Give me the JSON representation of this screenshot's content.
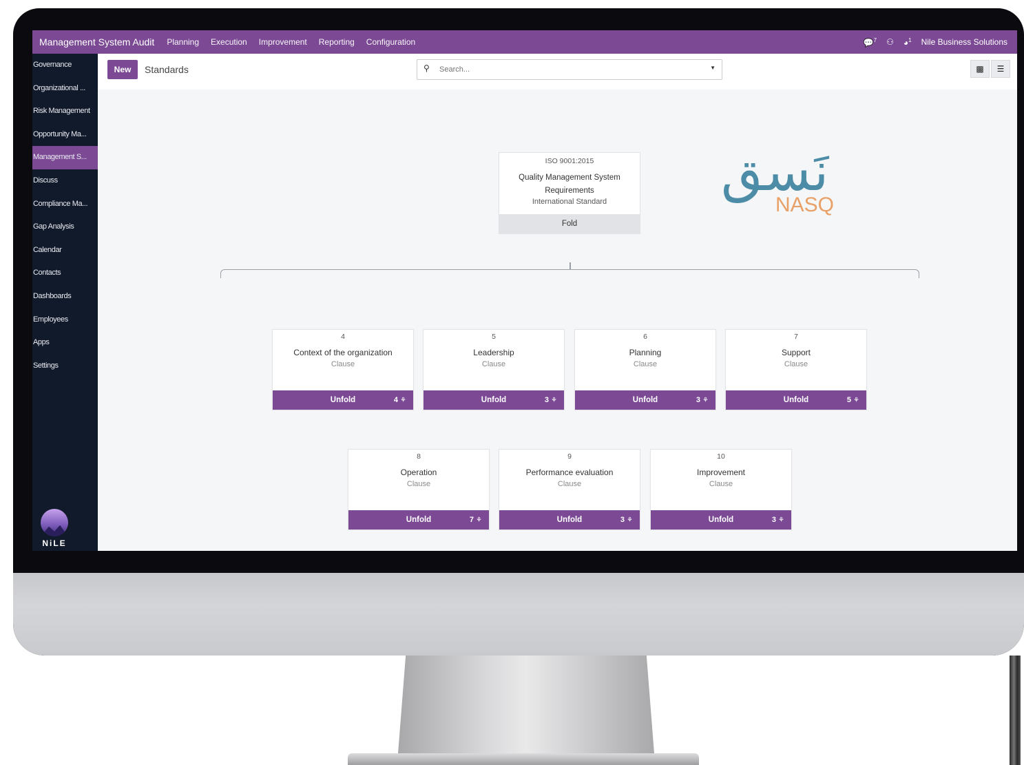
{
  "topbar": {
    "app_title": "Management System Audit",
    "menu": [
      "Planning",
      "Execution",
      "Improvement",
      "Reporting",
      "Configuration"
    ],
    "chat_badge": "7",
    "activity_badge": "1",
    "company": "Nile Business Solutions"
  },
  "sidebar": {
    "items": [
      "Governance",
      "Organizational ...",
      "Risk Management",
      "Opportunity Ma...",
      "Management S...",
      "Discuss",
      "Compliance Ma...",
      "Gap Analysis",
      "Calendar",
      "Contacts",
      "Dashboards",
      "Employees",
      "Apps",
      "Settings"
    ],
    "active_index": 4,
    "logo_text": "NiLE"
  },
  "control": {
    "new_label": "New",
    "breadcrumb": "Standards",
    "search_placeholder": "Search..."
  },
  "root": {
    "standard": "ISO 9001:2015",
    "title_line1": "Quality Management System",
    "title_line2": "Requirements",
    "subtitle": "International Standard",
    "fold_label": "Fold"
  },
  "clauses": [
    {
      "num": "4",
      "name": "Context of the organization",
      "type": "Clause",
      "button": "Unfold",
      "count": "4"
    },
    {
      "num": "5",
      "name": "Leadership",
      "type": "Clause",
      "button": "Unfold",
      "count": "3"
    },
    {
      "num": "6",
      "name": "Planning",
      "type": "Clause",
      "button": "Unfold",
      "count": "3"
    },
    {
      "num": "7",
      "name": "Support",
      "type": "Clause",
      "button": "Unfold",
      "count": "5"
    },
    {
      "num": "8",
      "name": "Operation",
      "type": "Clause",
      "button": "Unfold",
      "count": "7"
    },
    {
      "num": "9",
      "name": "Performance evaluation",
      "type": "Clause",
      "button": "Unfold",
      "count": "3"
    },
    {
      "num": "10",
      "name": "Improvement",
      "type": "Clause",
      "button": "Unfold",
      "count": "3"
    }
  ],
  "brand": {
    "arabic": "نَسق",
    "latin": "NASQ"
  },
  "colors": {
    "accent": "#7c4a95",
    "sidebar_bg": "#111a2a",
    "fold_bg": "#e1e3e6",
    "nasq_teal": "#4d8ca6",
    "nasq_orange": "#e9a066"
  },
  "icons": [
    "chat-icon",
    "user-icon",
    "activity-icon",
    "search-icon",
    "dropdown-caret-icon",
    "hierarchy-view-icon",
    "list-view-icon",
    "org-chart-icon"
  ]
}
